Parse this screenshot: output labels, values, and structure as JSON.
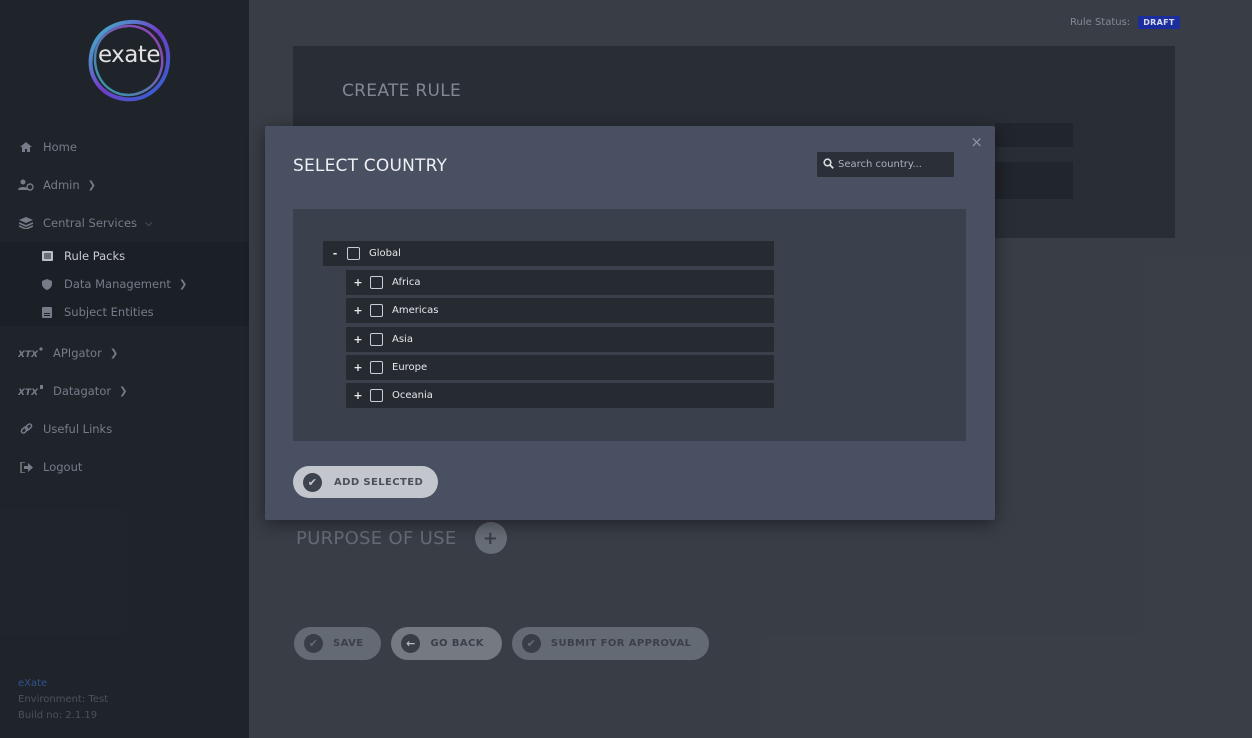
{
  "sidebar": {
    "logo_text": "exate",
    "nav": {
      "home": "Home",
      "admin": "Admin",
      "central_services": "Central Services",
      "rule_packs": "Rule Packs",
      "data_management": "Data Management",
      "subject_entities": "Subject Entities",
      "apigator": "APIgator",
      "datagator": "Datagator",
      "useful_links": "Useful Links",
      "logout": "Logout"
    },
    "footer": {
      "brand": "eXate",
      "environment": "Environment: Test",
      "build": "Build no: 2.1.19"
    }
  },
  "header": {
    "rule_status_label": "Rule Status:",
    "rule_status_value": "DRAFT"
  },
  "page": {
    "create_title": "CREATE RULE",
    "purpose_label": "PURPOSE OF USE",
    "buttons": {
      "save": "SAVE",
      "go_back": "GO BACK",
      "submit": "SUBMIT FOR APPROVAL"
    }
  },
  "modal": {
    "title": "SELECT COUNTRY",
    "close": "×",
    "search_placeholder": "Search country...",
    "tree": {
      "root": {
        "toggle": "-",
        "label": "Global"
      },
      "children": [
        {
          "toggle": "+",
          "label": "Africa"
        },
        {
          "toggle": "+",
          "label": "Americas"
        },
        {
          "toggle": "+",
          "label": "Asia"
        },
        {
          "toggle": "+",
          "label": "Europe"
        },
        {
          "toggle": "+",
          "label": "Oceania"
        }
      ]
    },
    "add_button": "ADD SELECTED"
  },
  "colors": {
    "sidebar_bg": "#1f232a",
    "main_bg": "#3b4048",
    "modal_bg": "#485061",
    "badge_bg": "#1c2fa8"
  }
}
